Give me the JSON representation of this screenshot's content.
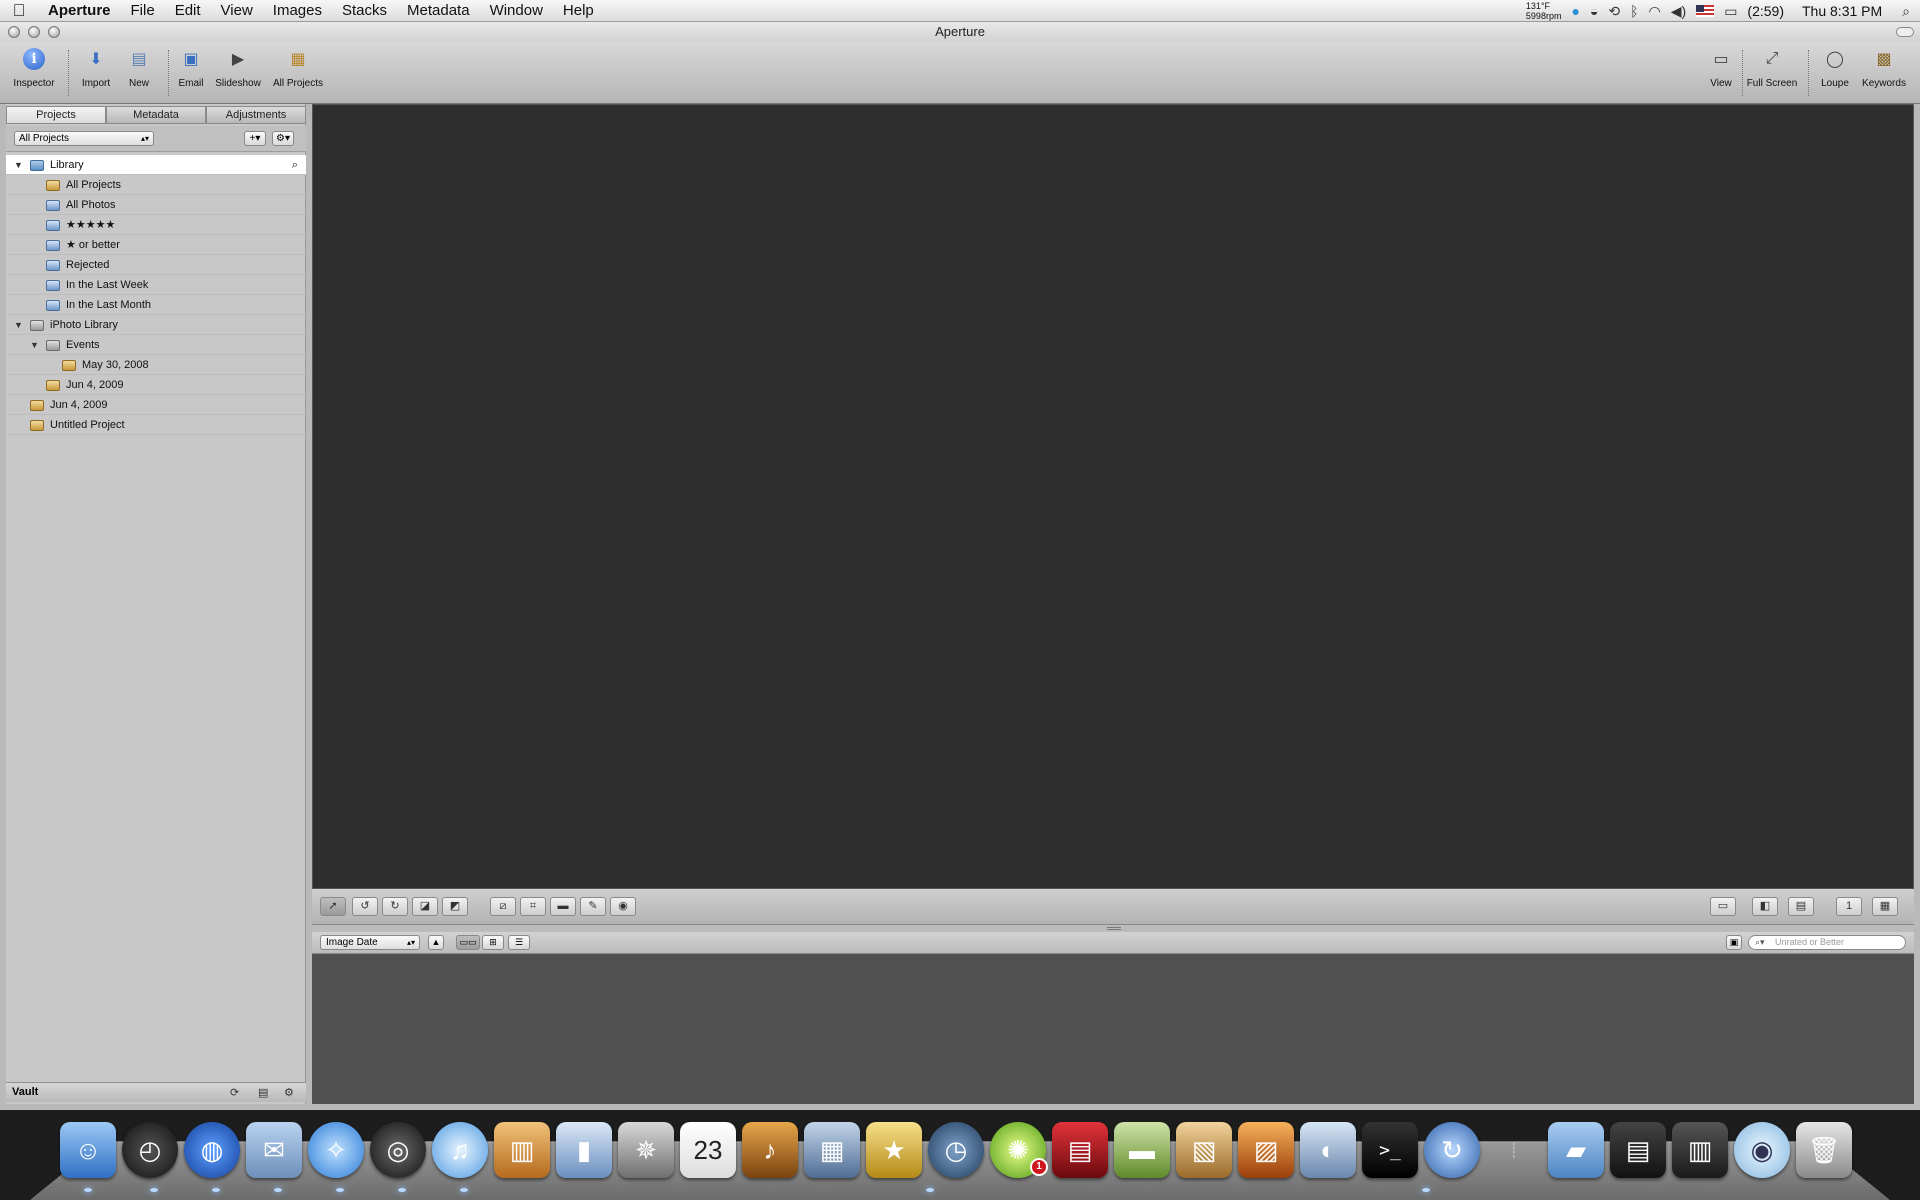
{
  "menubar": {
    "app_name": "Aperture",
    "menus": [
      "File",
      "Edit",
      "View",
      "Images",
      "Stacks",
      "Metadata",
      "Window",
      "Help"
    ],
    "temp": "131°F",
    "fan": "5998rpm",
    "battery": "(2:59)",
    "clock": "Thu 8:31 PM"
  },
  "window": {
    "title": "Aperture"
  },
  "toolbar": {
    "inspector": "Inspector",
    "import": "Import",
    "new": "New",
    "email": "Email",
    "slideshow": "Slideshow",
    "all_projects": "All Projects",
    "view": "View",
    "full_screen": "Full Screen",
    "loupe": "Loupe",
    "keywords": "Keywords"
  },
  "panel": {
    "tabs": [
      "Projects",
      "Metadata",
      "Adjustments"
    ],
    "projects_select": "All Projects",
    "tree": [
      {
        "label": "Library",
        "level": 0,
        "icon": "folder",
        "expanded": true,
        "selected": true
      },
      {
        "label": "All Projects",
        "level": 1,
        "icon": "project"
      },
      {
        "label": "All Photos",
        "level": 1,
        "icon": "album"
      },
      {
        "label": "★★★★★",
        "level": 1,
        "icon": "album"
      },
      {
        "label": "★ or better",
        "level": 1,
        "icon": "album"
      },
      {
        "label": "Rejected",
        "level": 1,
        "icon": "album"
      },
      {
        "label": "In the Last Week",
        "level": 1,
        "icon": "album"
      },
      {
        "label": "In the Last Month",
        "level": 1,
        "icon": "album"
      },
      {
        "label": "iPhoto Library",
        "level": 0,
        "icon": "grayf",
        "expanded": true
      },
      {
        "label": "Events",
        "level": 1,
        "icon": "grayf",
        "expanded": true
      },
      {
        "label": "May 30, 2008",
        "level": 2,
        "icon": "project"
      },
      {
        "label": "Jun 4, 2009",
        "level": 1,
        "icon": "project"
      },
      {
        "label": "Jun 4, 2009",
        "level": 0,
        "icon": "project"
      },
      {
        "label": "Untitled Project",
        "level": 0,
        "icon": "project"
      }
    ],
    "vault": "Vault"
  },
  "browser": {
    "sort": "Image Date",
    "filter_placeholder": "Unrated or Better"
  }
}
